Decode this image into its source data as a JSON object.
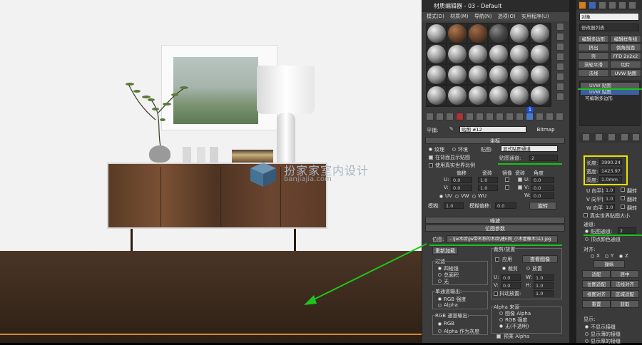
{
  "viewport": {
    "watermark_text": "扮家家室内设计",
    "watermark_sub": "banjiajia.com"
  },
  "material_editor": {
    "title": "材质编辑器 - 03 - Default",
    "menu": [
      "模式(D)",
      "材质(M)",
      "导航(N)",
      "选项(O)",
      "实用程序(U)"
    ],
    "map_label": "平铺:",
    "map_name": "贴图 #12",
    "map_type": "Bitmap",
    "badge": "1",
    "coords": {
      "title": "坐标",
      "texture": "纹理",
      "environ": "环境",
      "mapping_label": "贴图:",
      "mapping_value": "显式贴图通道",
      "show_back": "在背面显示贴图",
      "real_world": "使用真实世界比例",
      "channel_label": "贴图通道:",
      "channel_value": "2",
      "offset": "偏移",
      "tiling": "瓷砖",
      "mirror": "镜像",
      "tile": "瓷砖",
      "angle": "角度",
      "u": "U:",
      "v": "V:",
      "w": "W:",
      "u_offset": "0.0",
      "v_offset": "0.0",
      "u_tiling": "1.0",
      "v_tiling": "1.0",
      "u_angle": "0.0",
      "v_angle": "0.0",
      "w_angle": "0.0",
      "uv": "UV",
      "vw": "VW",
      "wu": "WU",
      "blur_label": "模糊:",
      "blur_value": "1.0",
      "blur_offset_label": "模糊偏移:",
      "blur_offset_value": "0.0",
      "rotate": "旋转"
    },
    "noise": "噪波",
    "bitmap_params": {
      "title": "位图参数",
      "bitmap_label": "位图:",
      "bitmap_path": "...\\jw木纹\\jw带名称的木纹\\建E网_小木屋橡木(山).jpg",
      "reload": "重新加载",
      "crop_title": "裁剪/放置",
      "apply": "应用",
      "view_image": "查看图像",
      "crop": "裁剪",
      "place": "放置",
      "u": "U:",
      "w": "W:",
      "v": "V:",
      "h": "H:",
      "u_val": "0.0",
      "w_val": "1.0",
      "v_val": "0.0",
      "h_val": "1.0",
      "jitter": "抖动放置:",
      "jitter_val": "1.0",
      "filter_title": "过滤",
      "four_point": "四棱锥",
      "summed": "总面积",
      "none": "无",
      "mono_title": "单通道输出:",
      "rgb_intensity": "RGB 强度",
      "alpha": "Alpha",
      "rgb_title": "RGB 通道输出:",
      "rgb": "RGB",
      "alpha_gray": "Alpha 作为灰度",
      "alpha_src_title": "Alpha 来源",
      "img_alpha": "图像 Alpha",
      "rgb_int2": "RGB 强度",
      "opaque": "无(不透明)",
      "premult": "预乘 Alpha"
    }
  },
  "command_panel": {
    "object_label": "对象",
    "modifier_list": "修改器列表",
    "buttons": [
      "编辑多边形",
      "编辑样条线",
      "挤出",
      "倒角剖面",
      "壳",
      "FFD 2x2x2",
      "涡轮平滑",
      "切片",
      "法线",
      "UVW 贴图"
    ],
    "stack": [
      "UVW 贴图",
      "UVW 贴图",
      "可编辑多边形"
    ],
    "length_label": "长度:",
    "length_val": "3990.24",
    "width_label": "宽度:",
    "width_val": "1423.97",
    "height_label": "高度:",
    "height_val": "1.0mm",
    "u_tile": "U 向平铺:",
    "v_tile": "V 向平铺:",
    "w_tile": "W 向平铺:",
    "tile_val": "1.0",
    "flip": "翻转",
    "real_world": "真实世界贴图大小",
    "channel_title": "通道:",
    "channel_label": "贴图通道:",
    "channel_val": "2",
    "vertex_color": "顶点颜色通道",
    "align_title": "对齐:",
    "x": "X",
    "y": "Y",
    "z": "Z",
    "manip": "操纵",
    "fit": "适配",
    "center": "居中",
    "bitmap_fit": "位图适配",
    "normal_align": "法线对齐",
    "view_align": "视图对齐",
    "region_fit": "区域适配",
    "reset": "重置",
    "acquire": "获取",
    "display_title": "显示:",
    "no_seams": "不显示接缝",
    "thin_seams": "显示薄的接缝",
    "thick_seams": "显示厚的接缝"
  }
}
